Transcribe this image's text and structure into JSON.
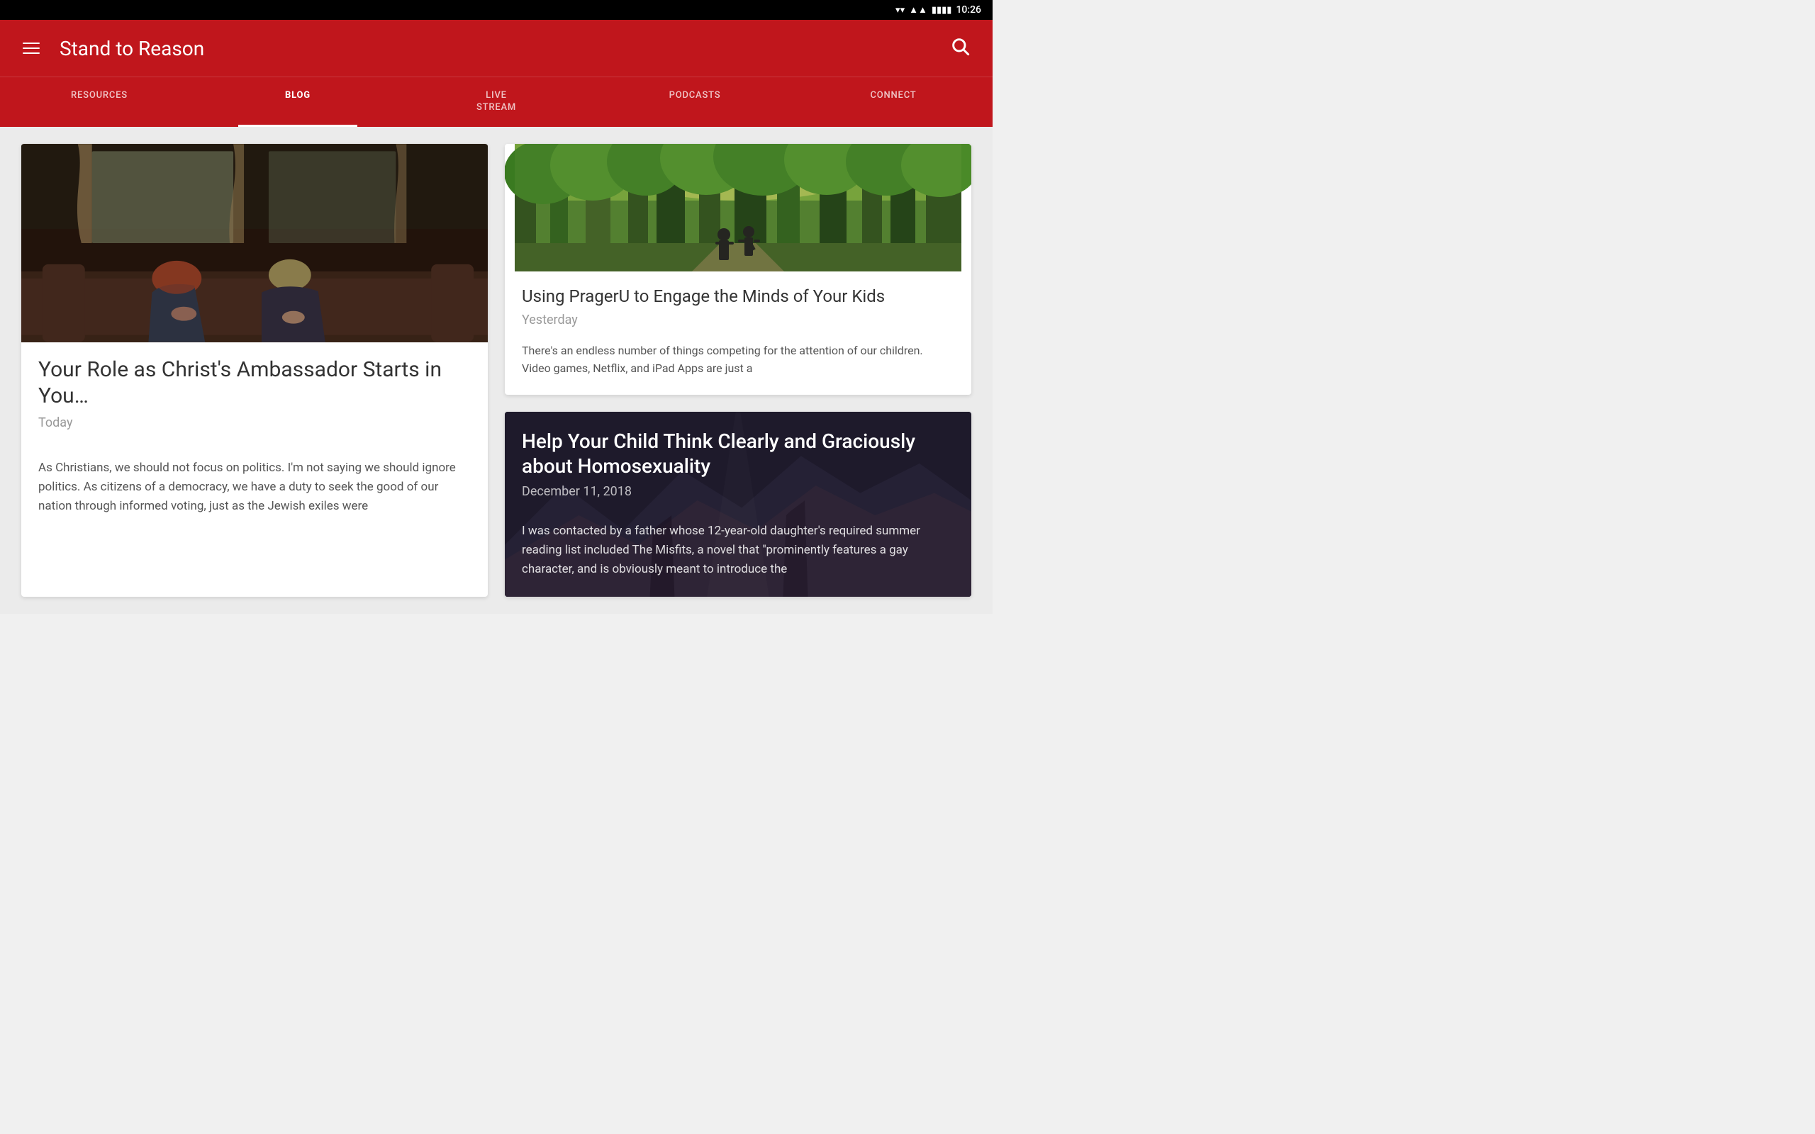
{
  "statusBar": {
    "time": "10:26",
    "wifiIcon": "▼",
    "signalIcon": "▲",
    "batteryIcon": "🔋"
  },
  "appBar": {
    "title": "Stand to Reason",
    "menuIcon": "hamburger",
    "searchIcon": "search"
  },
  "nav": {
    "tabs": [
      {
        "id": "resources",
        "label": "RESOURCES",
        "active": false
      },
      {
        "id": "blog",
        "label": "BLOG",
        "active": true
      },
      {
        "id": "livestream",
        "label": "LIVE\nSTREAM",
        "active": false
      },
      {
        "id": "podcasts",
        "label": "PODCASTS",
        "active": false
      },
      {
        "id": "connect",
        "label": "CONNECT",
        "active": false
      }
    ]
  },
  "articles": [
    {
      "id": "ambassador",
      "title": "Your Role as Christ's Ambassador Starts in You…",
      "date": "Today",
      "excerpt": "As Christians, we should not focus on politics. I'm not saying we should ignore politics. As citizens of a democracy, we have a duty to seek the good of our nation through informed voting, just as the Jewish exiles were",
      "imageType": "praying",
      "featured": true
    },
    {
      "id": "prageru",
      "title": "Using PragerU to Engage the Minds of Your Kids",
      "date": "Yesterday",
      "excerpt": "There's an endless number of things competing for the attention of our children. Video games, Netflix, and iPad Apps are just a",
      "imageType": "forest",
      "featured": false
    },
    {
      "id": "homosexuality",
      "title": "Help Your Child Think Clearly and Graciously about Homosexuality",
      "date": "December 11, 2018",
      "excerpt": "I was contacted by a father whose 12-year-old daughter's required summer reading list included The Misfits, a novel that \"prominently features a gay character, and is obviously meant to introduce the",
      "imageType": "dark",
      "featured": false,
      "dark": true
    }
  ]
}
